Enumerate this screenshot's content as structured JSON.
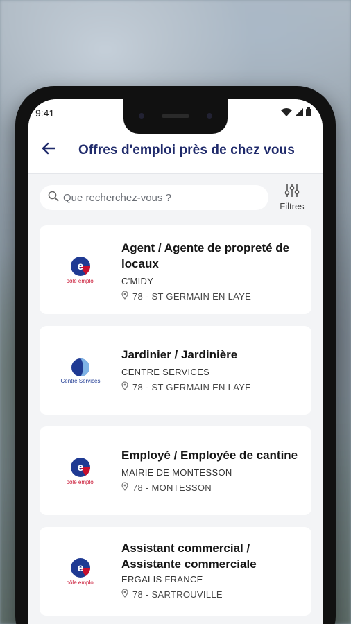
{
  "status_bar": {
    "time": "9:41"
  },
  "header": {
    "title": "Offres d'emploi près de chez vous"
  },
  "search": {
    "placeholder": "Que recherchez-vous ?",
    "filters_label": "Filtres"
  },
  "jobs": [
    {
      "logo": "pole-emploi-logo",
      "logo_text": "pôle emploi",
      "title": "Agent / Agente de propreté de locaux",
      "company": "C'MIDY",
      "location": "78 - ST GERMAIN EN LAYE"
    },
    {
      "logo": "centre-services-logo",
      "logo_text": "Centre Services",
      "title": "Jardinier / Jardinière",
      "company": "CENTRE SERVICES",
      "location": "78 - ST GERMAIN EN LAYE"
    },
    {
      "logo": "pole-emploi-logo",
      "logo_text": "pôle emploi",
      "title": "Employé / Employée de cantine",
      "company": "MAIRIE DE MONTESSON",
      "location": "78 - MONTESSON"
    },
    {
      "logo": "pole-emploi-logo",
      "logo_text": "pôle emploi",
      "title": "Assistant commercial / Assistante commerciale",
      "company": "ERGALIS FRANCE",
      "location": "78 - SARTROUVILLE"
    }
  ],
  "colors": {
    "title": "#1f2a6b",
    "accent_blue": "#1f3a93",
    "pole_red": "#c8102e"
  }
}
